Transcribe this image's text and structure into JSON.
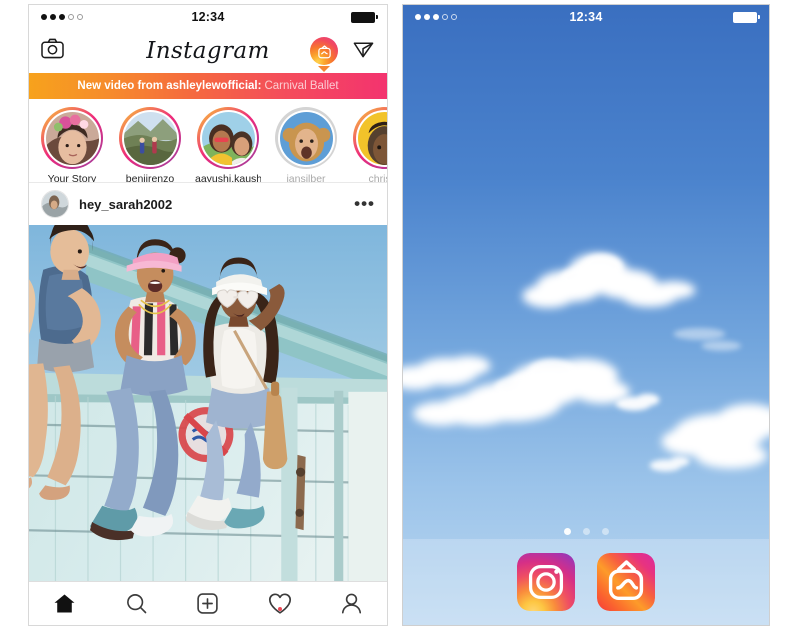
{
  "meta": {
    "scene": "Two iPhone screenshots side by side showing the Instagram app feed and the iOS home screen with the Instagram and IGTV app icons"
  },
  "left_phone": {
    "status_bar": {
      "time": "12:34",
      "signal_dots_filled": 3,
      "signal_dots_total": 5,
      "battery_icon": "battery-full-icon"
    },
    "header": {
      "camera_icon": "camera-icon",
      "logo": "Instagram",
      "igtv_badge_icon": "igtv-icon",
      "direct_icon": "send-paper-plane-icon"
    },
    "banner": {
      "strong_text": "New video from ashleylewofficial:",
      "soft_text": "Carnival Ballet",
      "gradient_from": "#f7a21c",
      "gradient_to": "#f3336f"
    },
    "stories": [
      {
        "name": "Your Story",
        "state": "unread",
        "dim": false
      },
      {
        "name": "benjirenzo",
        "state": "unread",
        "dim": false
      },
      {
        "name": "aayushi.kaushik",
        "state": "unread",
        "dim": false
      },
      {
        "name": "iansilber",
        "state": "seen",
        "dim": true
      },
      {
        "name": "christe",
        "state": "unread",
        "dim": true
      }
    ],
    "post": {
      "username": "hey_sarah2002",
      "avatar_icon": "user-avatar",
      "more_options": "•••",
      "image_description": "Three friends sitting on the edge of a pale teal lifeguard tower against a bright blue sky"
    },
    "tab_bar": [
      {
        "name": "home-tab",
        "icon": "home-icon",
        "active": true,
        "badge": false
      },
      {
        "name": "search-tab",
        "icon": "search-icon",
        "active": false,
        "badge": false
      },
      {
        "name": "add-post-tab",
        "icon": "plus-square-icon",
        "active": false,
        "badge": false
      },
      {
        "name": "activity-tab",
        "icon": "heart-icon",
        "active": false,
        "badge": true
      },
      {
        "name": "profile-tab",
        "icon": "person-icon",
        "active": false,
        "badge": false
      }
    ]
  },
  "right_phone": {
    "status_bar": {
      "time": "12:34",
      "signal_dots_filled": 3,
      "signal_dots_total": 5,
      "battery_icon": "battery-full-icon"
    },
    "wallpaper": {
      "description": "Blue sky with white cumulus clouds",
      "sky_top": "#3a74c4",
      "sky_bottom": "#b9d6f0"
    },
    "page_dots": {
      "count": 3,
      "active_index": 0
    },
    "dock_apps": [
      {
        "label": "Instagram",
        "icon": "instagram-app-icon"
      },
      {
        "label": "IGTV",
        "icon": "igtv-app-icon"
      }
    ]
  }
}
